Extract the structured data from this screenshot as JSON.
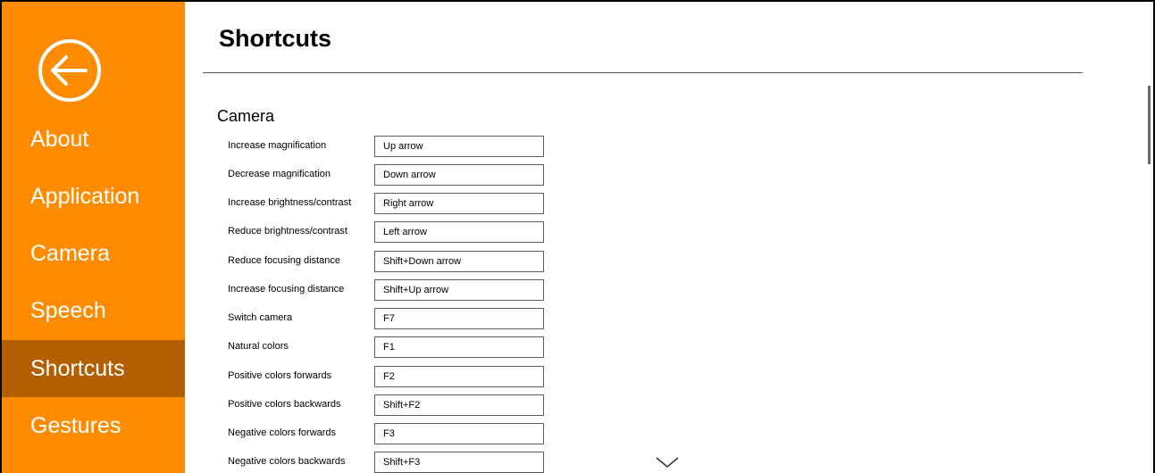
{
  "sidebar": {
    "back_icon": "back-arrow-circle-icon",
    "accent_color": "#ff8c00",
    "selected_color": "#b35f00",
    "items": [
      {
        "label": "About"
      },
      {
        "label": "Application"
      },
      {
        "label": "Camera"
      },
      {
        "label": "Speech"
      },
      {
        "label": "Shortcuts",
        "selected": true
      },
      {
        "label": "Gestures"
      }
    ]
  },
  "main": {
    "title": "Shortcuts",
    "section": "Camera",
    "shortcuts": [
      {
        "label": "Increase magnification",
        "value": "Up arrow"
      },
      {
        "label": "Decrease magnification",
        "value": "Down arrow"
      },
      {
        "label": "Increase brightness/contrast",
        "value": "Right arrow"
      },
      {
        "label": "Reduce brightness/contrast",
        "value": "Left arrow"
      },
      {
        "label": "Reduce focusing distance",
        "value": "Shift+Down arrow"
      },
      {
        "label": "Increase focusing distance",
        "value": "Shift+Up arrow"
      },
      {
        "label": "Switch camera",
        "value": "F7"
      },
      {
        "label": "Natural colors",
        "value": "F1"
      },
      {
        "label": "Positive colors forwards",
        "value": "F2"
      },
      {
        "label": "Positive colors backwards",
        "value": "Shift+F2"
      },
      {
        "label": "Negative colors forwards",
        "value": "F3"
      },
      {
        "label": "Negative colors backwards",
        "value": "Shift+F3"
      }
    ],
    "scroll_icon": "chevron-down-icon"
  }
}
